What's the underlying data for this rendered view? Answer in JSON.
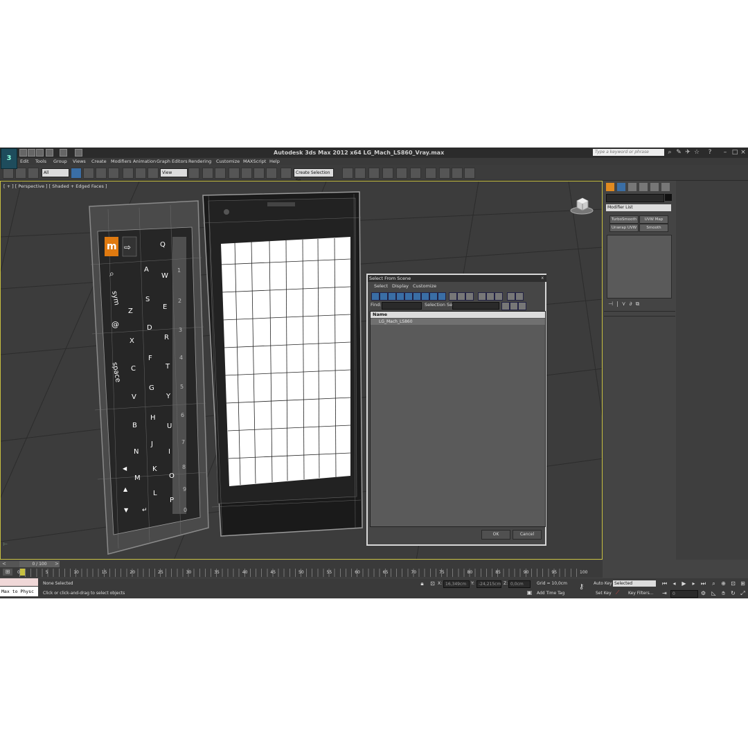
{
  "window": {
    "title": "Autodesk 3ds Max  2012 x64      LG_Mach_LS860_Vray.max",
    "search_placeholder": "Type a keyword or phrase"
  },
  "menu": [
    "Edit",
    "Tools",
    "Group",
    "Views",
    "Create",
    "Modifiers",
    "Animation",
    "Graph Editors",
    "Rendering",
    "Customize",
    "MAXScript",
    "Help"
  ],
  "toolbar": {
    "filter_value": "All",
    "ref_coord_value": "View",
    "selection_set_placeholder": "Create Selection Se"
  },
  "viewport": {
    "label": "[ + ] [ Perspective ] [ Shaded + Edged Faces ]"
  },
  "keyboard": {
    "brand_key": "m",
    "keys_row1": [
      "Q",
      "W",
      "E",
      "R",
      "T",
      "Y",
      "U",
      "I",
      "O",
      "P"
    ],
    "keys_row2": [
      "A",
      "S",
      "D",
      "F",
      "G",
      "H",
      "J",
      "K",
      "L"
    ],
    "keys_row3": [
      "Z",
      "X",
      "C",
      "V",
      "B",
      "N",
      "M"
    ],
    "digits": [
      "1",
      "2",
      "3",
      "4",
      "5",
      "6",
      "7",
      "8",
      "9",
      "0"
    ],
    "sym": "sym",
    "at": "@",
    "space": "space"
  },
  "select_dialog": {
    "title": "Select From Scene",
    "close": "x",
    "menu": [
      "Select",
      "Display",
      "Customize"
    ],
    "find_label": "Find:",
    "selection_set_label": "Selection Set:",
    "column_name": "Name",
    "items": [
      "LG_Mach_LS860"
    ],
    "ok_label": "OK",
    "cancel_label": "Cancel"
  },
  "command_panel": {
    "modifier_list": "Modifier List",
    "buttons": [
      "TurboSmooth",
      "UVW Map",
      "Unwrap UVW",
      "Smooth"
    ]
  },
  "timeline": {
    "frame_display": "0 / 100",
    "ticks": [
      "0",
      "5",
      "10",
      "15",
      "20",
      "25",
      "30",
      "35",
      "40",
      "45",
      "50",
      "55",
      "60",
      "65",
      "70",
      "75",
      "80",
      "85",
      "90",
      "95",
      "100"
    ]
  },
  "status": {
    "maxscript_listener": "Max to Physc",
    "selection_status": "None Selected",
    "prompt": "Click or click-and-drag to select objects",
    "x_label": "X:",
    "x_value": "16,349cm",
    "y_label": "Y:",
    "y_value": "-24,215cm",
    "z_label": "Z:",
    "z_value": "0,0cm",
    "grid": "Grid = 10,0cm",
    "add_time_tag": "Add Time Tag",
    "auto_key": "Auto Key",
    "set_key": "Set Key",
    "selected_option": "Selected",
    "key_filters": "Key Filters...",
    "frame_value": "0"
  }
}
